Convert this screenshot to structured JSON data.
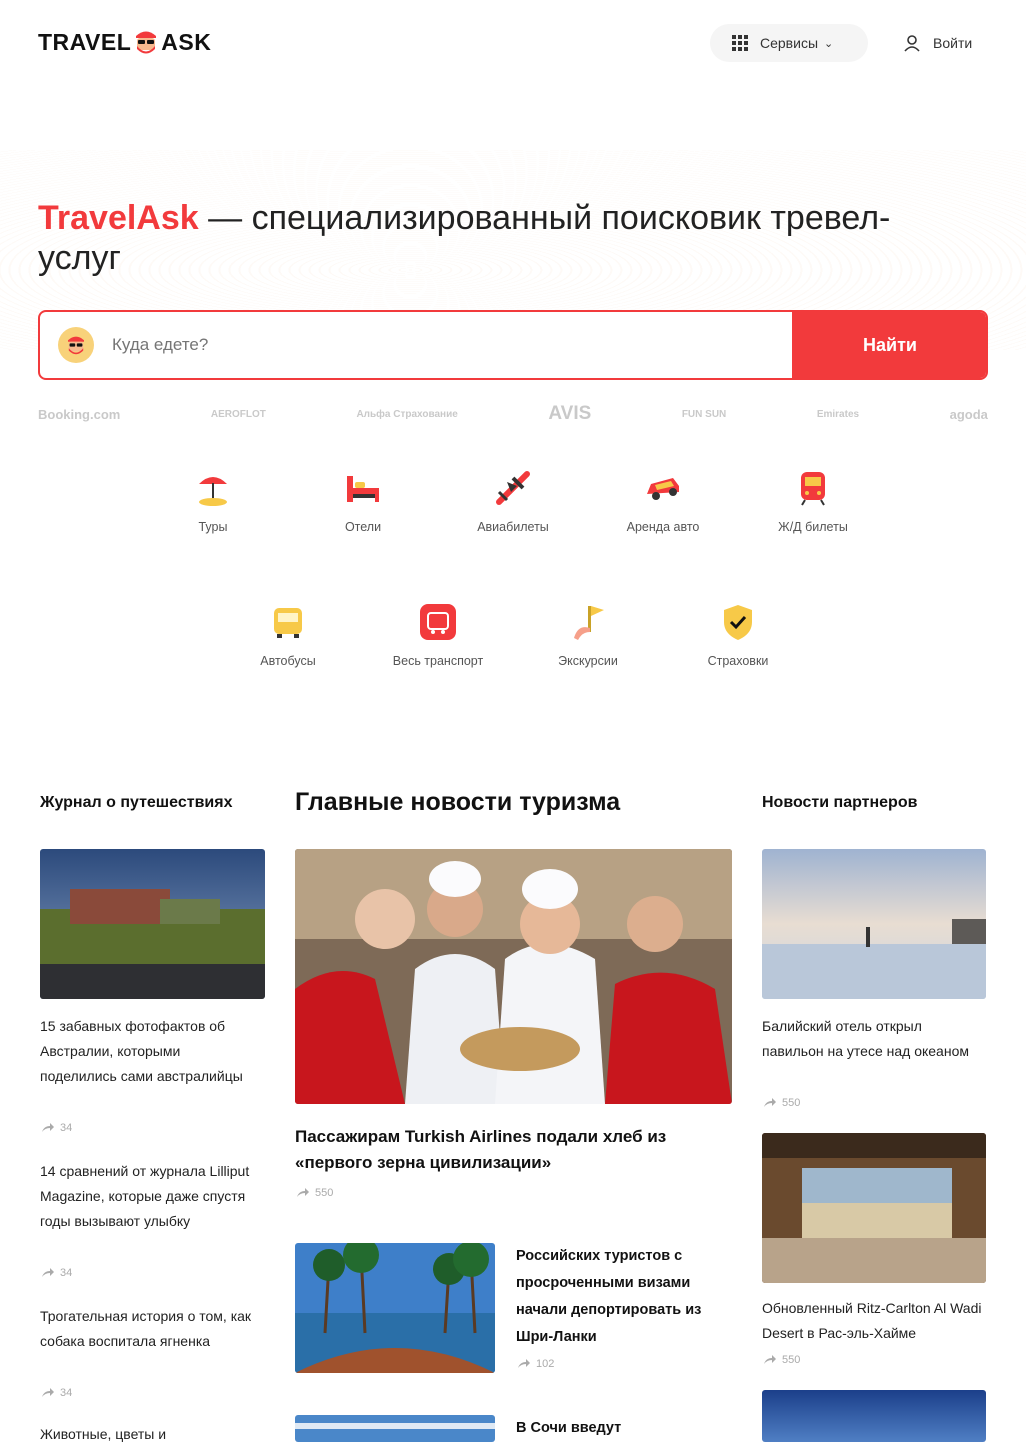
{
  "header": {
    "logo_left": "TRAVEL",
    "logo_right": "ASK",
    "services_label": "Сервисы",
    "login_label": "Войти"
  },
  "hero": {
    "brand": "TravelAsk",
    "title_rest": " — специализированный поисковик тревел-услуг",
    "search_placeholder": "Куда едете?",
    "search_button": "Найти"
  },
  "partners": [
    "Booking.com",
    "AEROFLOT",
    "Альфа Страхование",
    "AVIS",
    "FUN SUN",
    "Emirates",
    "agoda"
  ],
  "categories": [
    {
      "label": "Туры",
      "icon": "umbrella-icon"
    },
    {
      "label": "Отели",
      "icon": "bed-icon"
    },
    {
      "label": "Авиабилеты",
      "icon": "plane-icon"
    },
    {
      "label": "Аренда авто",
      "icon": "car-icon"
    },
    {
      "label": "Ж/Д билеты",
      "icon": "train-icon"
    },
    {
      "label": "Автобусы",
      "icon": "bus-icon"
    },
    {
      "label": "Весь транспорт",
      "icon": "transport-icon"
    },
    {
      "label": "Экскурсии",
      "icon": "flag-icon"
    },
    {
      "label": "Страховки",
      "icon": "shield-icon"
    }
  ],
  "journal": {
    "title": "Журнал о путешествиях",
    "articles": [
      {
        "text": "15 забавных фотофактов об Австралии, которыми поделились сами австралийцы",
        "shares": "34"
      },
      {
        "text": "14 сравнений от журнала Lilliput Magazine, которые даже спустя годы вызывают улыбку",
        "shares": "34"
      },
      {
        "text": "Трогательная история о том, как собака воспитала ягненка",
        "shares": "34"
      },
      {
        "text": "Животные, цветы и"
      }
    ]
  },
  "main_news": {
    "title": "Главные новости туризма",
    "lead": {
      "text": "Пассажирам Turkish Airlines подали хлеб из «первого зерна цивилизации»",
      "shares": "550"
    },
    "items": [
      {
        "text": "Российских туристов с просроченными визами начали депортировать из Шри-Ланки",
        "shares": "102"
      },
      {
        "text": "В Сочи введут"
      }
    ]
  },
  "partner_news": {
    "title": "Новости партнеров",
    "items": [
      {
        "text": "Балийский отель открыл павильон на утесе над океаном",
        "shares": "550"
      },
      {
        "text": "Обновленный Ritz-Carlton Al Wadi Desert в Рас-эль-Хайме",
        "shares": "550"
      }
    ]
  },
  "colors": {
    "accent": "#f23a3c",
    "text": "#1a1a1a",
    "muted": "#aaaaaa"
  }
}
